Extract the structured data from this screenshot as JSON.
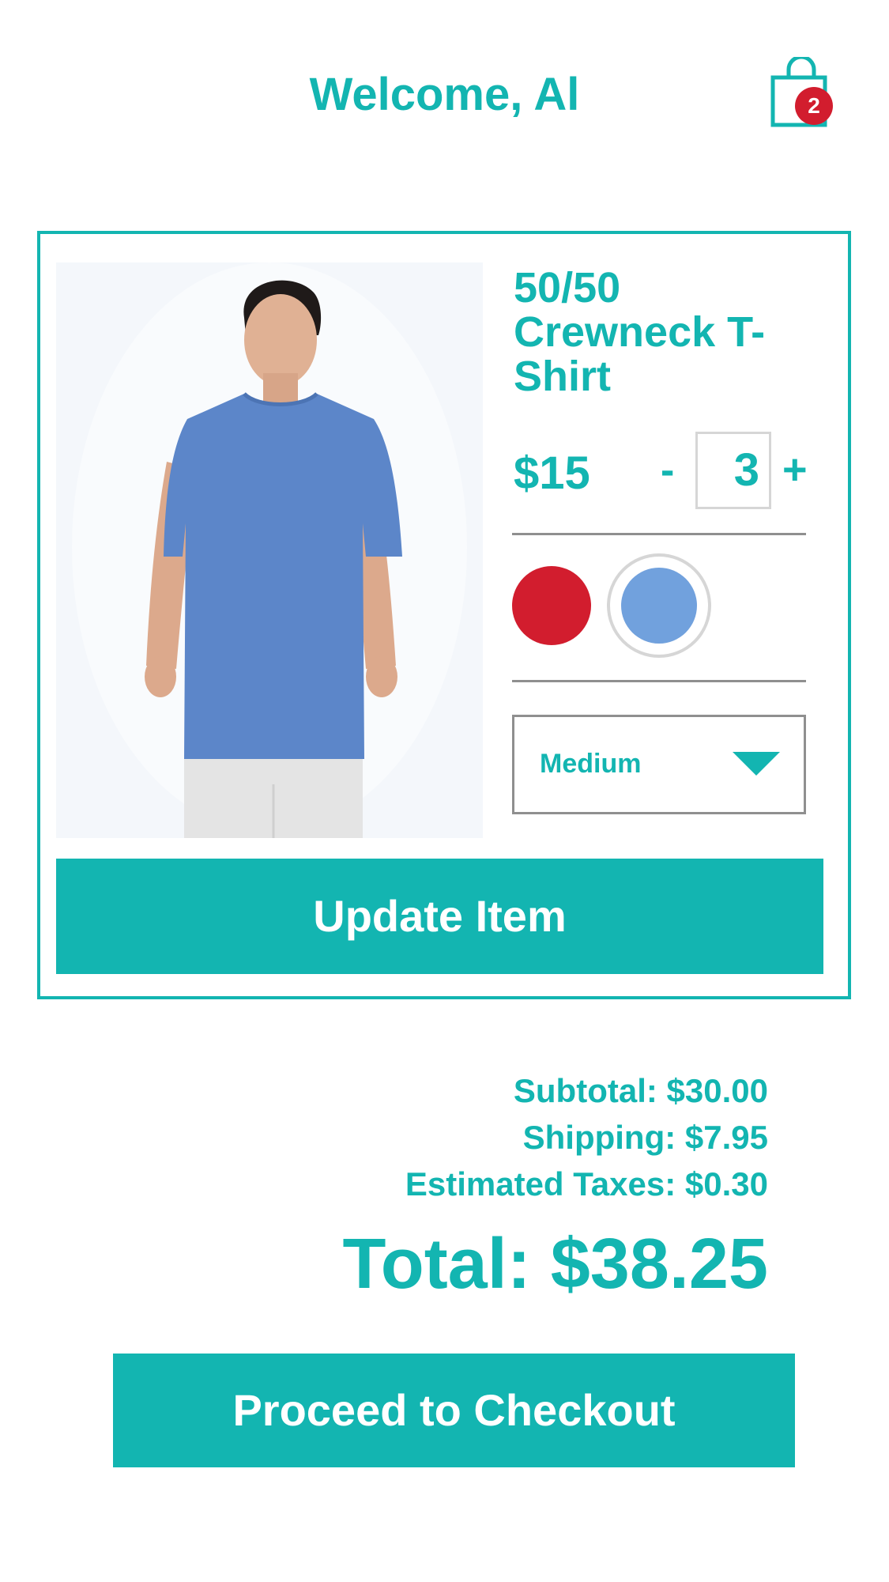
{
  "header": {
    "title": "Welcome, Al",
    "cart_icon": "shopping-bag-icon",
    "cart_count": "2"
  },
  "product": {
    "name": "50/50 Crewneck T-Shirt",
    "price": "$15",
    "quantity": "3",
    "qty_minus": "-",
    "qty_plus": "+",
    "colors": [
      {
        "name": "red",
        "hex": "#d21d2e",
        "selected": false
      },
      {
        "name": "blue",
        "hex": "#71a1dd",
        "selected": true
      }
    ],
    "size": "Medium",
    "update_label": "Update Item"
  },
  "summary": {
    "subtotal": "Subtotal: $30.00",
    "shipping": "Shipping: $7.95",
    "taxes": "Estimated Taxes: $0.30",
    "total": "Total: $38.25"
  },
  "checkout_label": "Proceed to Checkout",
  "colors": {
    "accent": "#13b5b1",
    "badge": "#d21d2e"
  }
}
